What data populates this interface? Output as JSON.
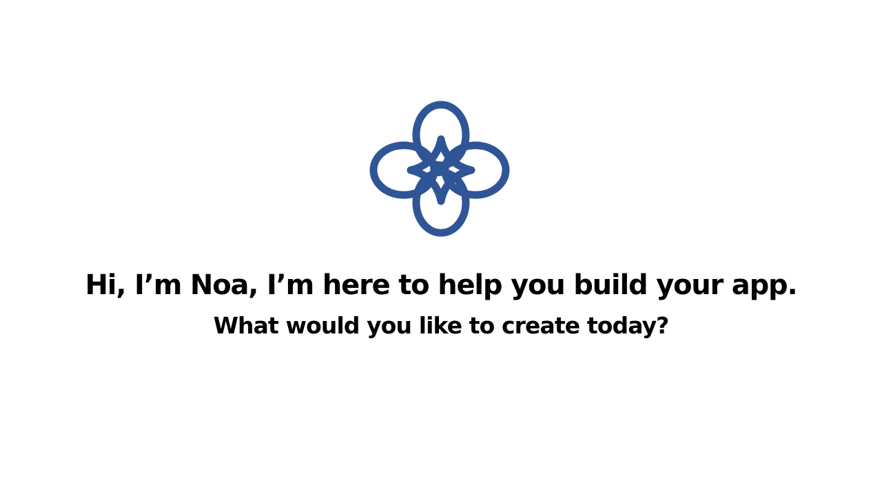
{
  "assistant": {
    "greeting": "Hi, I’m Noa, I’m here to help you build your app.",
    "prompt": "What would you like to create today?",
    "icon": "sparkle-flower-logo-icon"
  },
  "colors": {
    "logo": "#2F5597",
    "text": "#000000",
    "background": "#FFFFFF"
  }
}
